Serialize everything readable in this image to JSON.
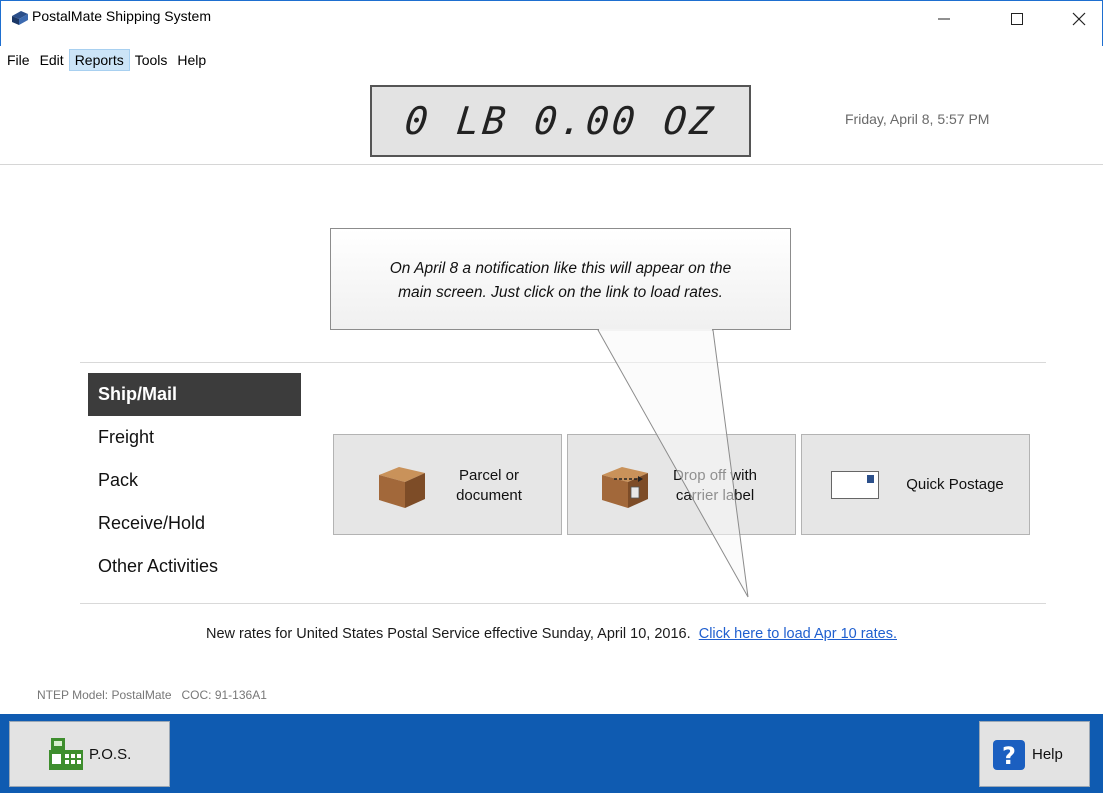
{
  "window": {
    "title": "PostalMate Shipping System"
  },
  "menu": [
    "File",
    "Edit",
    "Reports",
    "Tools",
    "Help"
  ],
  "scale": {
    "reading": "0 LB 0.00 OZ"
  },
  "datetime": "Friday, April 8, 5:57 PM",
  "callout": {
    "line1": "On April 8 a notification like this will appear on the",
    "line2": "main screen. Just click on the link to load rates."
  },
  "nav": [
    "Ship/Mail",
    "Freight",
    "Pack",
    "Receive/Hold",
    "Other Activities"
  ],
  "actions": {
    "parcel": {
      "line1": "Parcel or",
      "line2": "document"
    },
    "dropoff": {
      "line1": "Drop off with",
      "line2": "carrier label"
    },
    "quick": {
      "label": "Quick Postage"
    }
  },
  "rates": {
    "message": "New rates for United States Postal Service effective Sunday, April 10, 2016.",
    "link": "Click here to load Apr 10 rates."
  },
  "ntep": "NTEP Model: PostalMate   COC: 91-136A1",
  "bottom": {
    "pos_label": "P.O.S.",
    "help_label": "Help"
  },
  "colors": {
    "bottom_bar": "#0f5bb1",
    "nav_active": "#3c3c3c",
    "link": "#1f5fcf"
  }
}
